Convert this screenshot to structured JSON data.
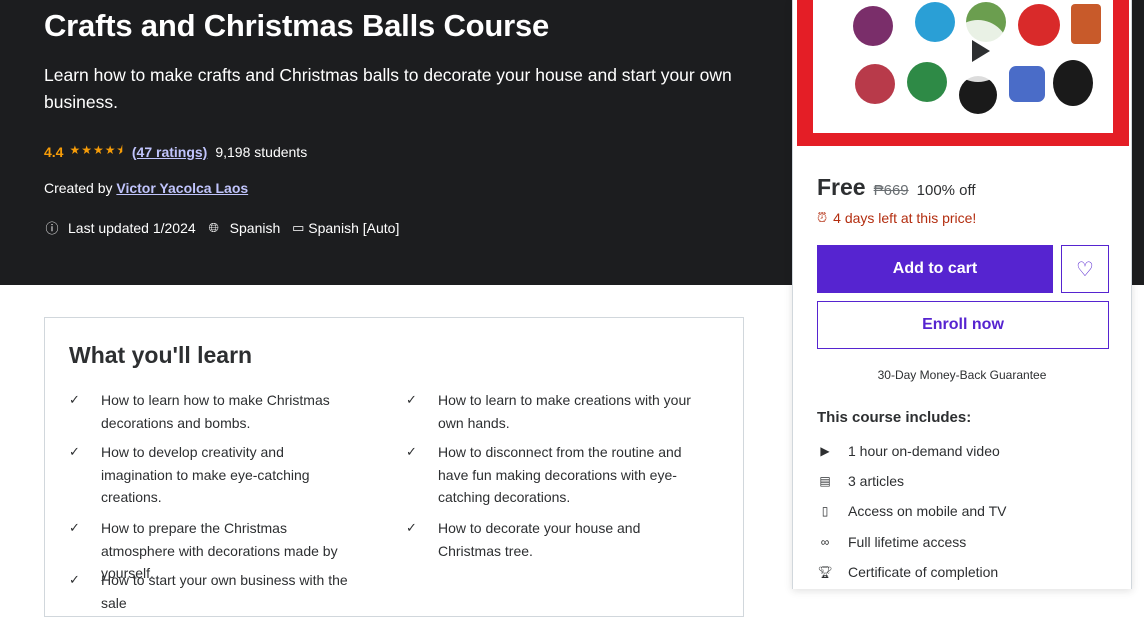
{
  "course": {
    "title": "Crafts and Christmas Balls Course",
    "subtitle": "Learn how to make crafts and Christmas balls to decorate your house and start your own business.",
    "rating": "4.4",
    "stars": "★★★★⯨",
    "ratings_count": "(47 ratings)",
    "students": "9,198 students",
    "created_by_label": "Created by",
    "instructor": "Victor Yacolca Laos",
    "last_updated": "Last updated 1/2024",
    "language": "Spanish",
    "captions": "Spanish [Auto]"
  },
  "learn": {
    "heading": "What you'll learn",
    "items": [
      "How to learn how to make Christmas decorations and bombs.",
      "How to learn to make creations with your own hands.",
      "How to develop creativity and imagination to make eye-catching creations.",
      "How to disconnect from the routine and have fun making decorations with eye-catching decorations.",
      "How to prepare the Christmas atmosphere with decorations made by yourself.",
      "How to decorate your house and Christmas tree.",
      "How to start your own business with the sale"
    ]
  },
  "card": {
    "price": "Free",
    "original_price": "₱669",
    "discount": "100% off",
    "deadline": "4 days left at this price!",
    "add_to_cart": "Add to cart",
    "enroll": "Enroll now",
    "guarantee": "30-Day Money-Back Guarantee",
    "includes_heading": "This course includes:",
    "includes": [
      {
        "icon": "video-icon",
        "label": "1 hour on-demand video"
      },
      {
        "icon": "article-icon",
        "label": "3 articles"
      },
      {
        "icon": "mobile-icon",
        "label": "Access on mobile and TV"
      },
      {
        "icon": "infinity-icon",
        "label": "Full lifetime access"
      },
      {
        "icon": "trophy-icon",
        "label": "Certificate of completion"
      }
    ]
  },
  "colors": {
    "hero_bg": "#1c1d1f",
    "accent": "#5624d0",
    "rating": "#f69c08",
    "link": "#c0c4fc",
    "deadline": "#b32d0f"
  }
}
